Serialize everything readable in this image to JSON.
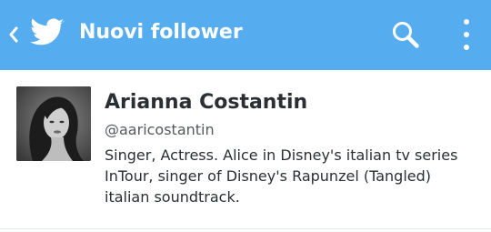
{
  "colors": {
    "action_bar": "#55acee",
    "text_primary": "#292f33",
    "text_secondary": "#55595c",
    "divider": "#e1e8ed"
  },
  "action_bar": {
    "title": "Nuovi follower",
    "icons": {
      "back": "chevron-left-icon",
      "logo": "twitter-bird-icon",
      "search": "search-icon",
      "overflow": "more-vertical-icon"
    }
  },
  "users": [
    {
      "name": "Arianna Costantin",
      "handle": "@aaricostantin",
      "bio_lines": [
        "Singer, Actress. Alice in Disney's italian tv series",
        "InTour, singer of Disney's Rapunzel (Tangled)",
        "italian soundtrack."
      ]
    }
  ]
}
